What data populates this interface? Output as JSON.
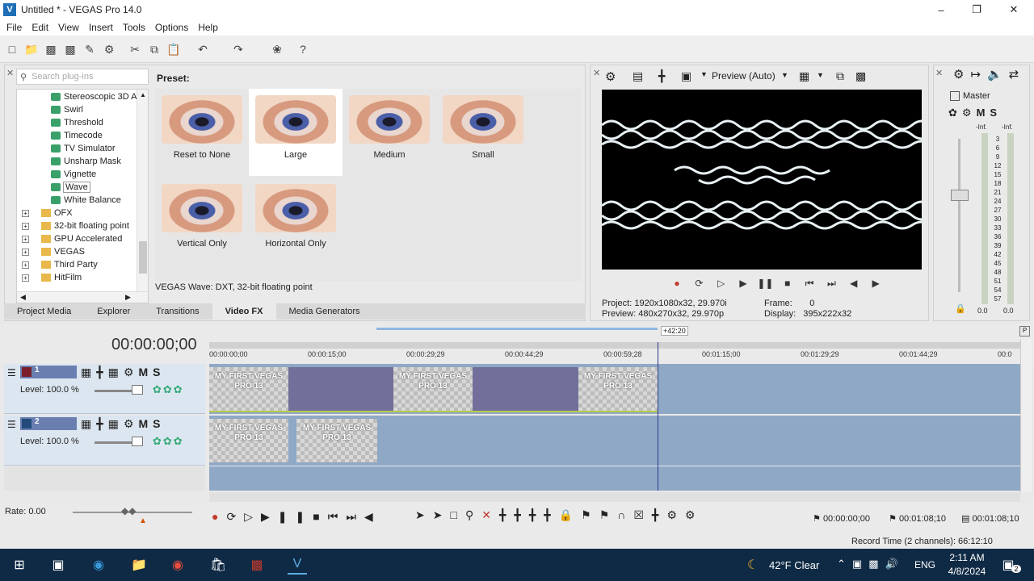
{
  "window": {
    "title": "Untitled * - VEGAS Pro 14.0"
  },
  "menu": [
    "File",
    "Edit",
    "View",
    "Insert",
    "Tools",
    "Options",
    "Help"
  ],
  "fx": {
    "search_placeholder": "Search plug-ins",
    "tree": [
      {
        "label": "Stereoscopic 3D A",
        "kind": "fx"
      },
      {
        "label": "Swirl",
        "kind": "fx"
      },
      {
        "label": "Threshold",
        "kind": "fx"
      },
      {
        "label": "Timecode",
        "kind": "fx"
      },
      {
        "label": "TV Simulator",
        "kind": "fx"
      },
      {
        "label": "Unsharp Mask",
        "kind": "fx"
      },
      {
        "label": "Vignette",
        "kind": "fx"
      },
      {
        "label": "Wave",
        "kind": "fx",
        "selected": true
      },
      {
        "label": "White Balance",
        "kind": "fx"
      },
      {
        "label": "OFX",
        "kind": "folder"
      },
      {
        "label": "32-bit floating point",
        "kind": "folder"
      },
      {
        "label": "GPU Accelerated",
        "kind": "folder"
      },
      {
        "label": "VEGAS",
        "kind": "folder"
      },
      {
        "label": "Third Party",
        "kind": "folder"
      },
      {
        "label": "HitFilm",
        "kind": "folder"
      }
    ],
    "preset_label": "Preset:",
    "presets": [
      "Reset to None",
      "Large",
      "Medium",
      "Small",
      "Vertical Only",
      "Horizontal Only"
    ],
    "description": "VEGAS Wave: DXT, 32-bit floating point",
    "tabs": [
      "Project Media",
      "Explorer",
      "Transitions",
      "Video FX",
      "Media Generators"
    ],
    "active_tab": "Video FX"
  },
  "preview": {
    "quality": "Preview (Auto)",
    "project_label": "Project:",
    "project_value": "1920x1080x32, 29.970i",
    "preview_label": "Preview:",
    "preview_value": "480x270x32, 29.970p",
    "frame_label": "Frame:",
    "frame_value": "0",
    "display_label": "Display:",
    "display_value": "395x222x32"
  },
  "master": {
    "label": "Master",
    "inf_left": "-Inf.",
    "inf_right": "-Inf.",
    "scale": [
      "3",
      "6",
      "9",
      "12",
      "15",
      "18",
      "21",
      "24",
      "27",
      "30",
      "33",
      "36",
      "39",
      "42",
      "45",
      "48",
      "51",
      "54",
      "57"
    ],
    "level_left": "0.0",
    "level_right": "0.0"
  },
  "timeline": {
    "timecode": "00:00:00;00",
    "loop_length": "+42:20",
    "ruler": [
      "00:00:00;00",
      "00:00:15;00",
      "00:00:29;29",
      "00:00:44;29",
      "00:00:59;28",
      "00:01:15;00",
      "00:01:29;29",
      "00:01:44;29",
      "00:0"
    ],
    "tracks": [
      {
        "number": "1",
        "level_label": "Level: 100.0 %"
      },
      {
        "number": "2",
        "level_label": "Level: 100.0 %"
      }
    ],
    "clip_title": "MY FIRST VEGAS PRO 13",
    "rate": "Rate: 0.00",
    "time_start": "00:00:00;00",
    "time_end": "00:01:08;10",
    "time_length": "00:01:08;10",
    "record_time": "Record Time (2 channels): 66:12:10"
  },
  "taskbar": {
    "weather": "42°F  Clear",
    "lang": "ENG",
    "time": "2:11 AM",
    "date": "4/8/2024",
    "notifications": "2"
  },
  "colors": {
    "accent": "#1f6fb8",
    "track_video": "#726f9a",
    "track_bg": "#8fa8c6"
  }
}
